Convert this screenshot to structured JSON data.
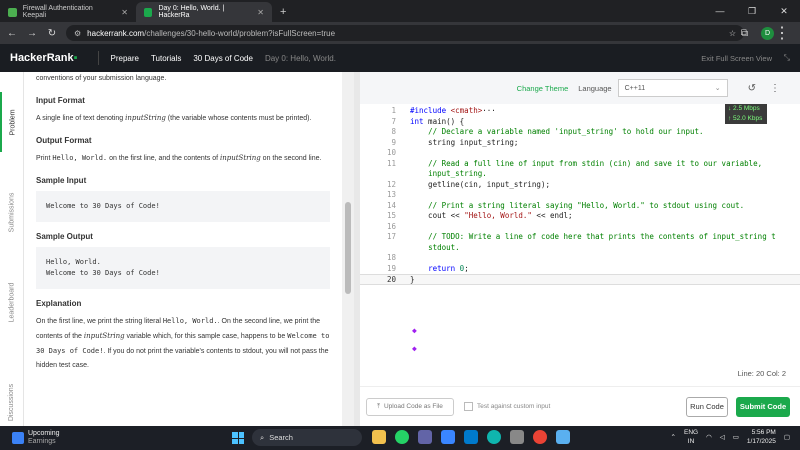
{
  "browser": {
    "tabs": [
      {
        "title": "Firewall Authentication Keepali",
        "fav_color": "#4caf50"
      },
      {
        "title": "Day 0: Hello, World. | HackerRa",
        "fav_color": "#1ba94c"
      }
    ],
    "url_domain": "hackerrank.com",
    "url_path": "/challenges/30-hello-world/problem?isFullScreen=true",
    "profile": "D"
  },
  "nav": {
    "logo": "HackerRank",
    "items": [
      "Prepare",
      "Tutorials",
      "30 Days of Code"
    ],
    "crumb": "Day 0: Hello, World.",
    "exit": "Exit Full Screen View"
  },
  "sidetabs": [
    "Problem",
    "Submissions",
    "Leaderboard",
    "Discussions"
  ],
  "problem": {
    "intro": "conventions of your submission language.",
    "input_h": "Input Format",
    "input_p1": "A single line of text denoting ",
    "input_var": "inputString",
    "input_p2": " (the variable whose contents must be printed).",
    "output_h": "Output Format",
    "output_p1": "Print ",
    "output_code": "Hello, World.",
    "output_p2": " on the first line, and the contents of ",
    "output_var": "inputString",
    "output_p3": " on the second line.",
    "sample_in_h": "Sample Input",
    "sample_in": "Welcome to 30 Days of Code!",
    "sample_out_h": "Sample Output",
    "sample_out": "Hello, World.\nWelcome to 30 Days of Code!",
    "expl_h": "Explanation",
    "expl_1": "On the first line, we print the string literal ",
    "expl_code1": "Hello, World.",
    "expl_2": ". On the second line, we print the contents of the ",
    "expl_var": "inputString",
    "expl_3": " variable which, for this sample case, happens to be ",
    "expl_code2": "Welcome to 30 Days of Code!",
    "expl_4": ". If you do not print the variable's contents to stdout, you will not pass the hidden test case."
  },
  "editor": {
    "change_theme": "Change Theme",
    "language_label": "Language",
    "language": "C++11",
    "net_down": "↓ 2.5 Mbps",
    "net_up": "↑ 52.0 Kbps",
    "status": "Line: 20 Col: 2",
    "upload": "Upload Code as File",
    "custom_input": "Test against custom input",
    "run": "Run Code",
    "submit": "Submit Code"
  },
  "taskbar": {
    "weather_title": "Upcoming",
    "weather_sub": "Earnings",
    "search": "Search",
    "lang1": "ENG",
    "lang2": "IN",
    "time": "5:56 PM",
    "date": "1/17/2025",
    "badge": "1"
  }
}
